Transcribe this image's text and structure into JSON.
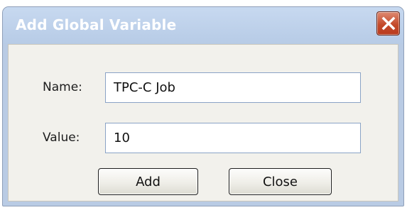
{
  "dialog": {
    "title": "Add Global Variable",
    "close_icon": "close-x-icon"
  },
  "form": {
    "name_label": "Name:",
    "name_value": "TPC-C Job",
    "value_label": "Value:",
    "value_value": "10"
  },
  "buttons": {
    "add_label": "Add",
    "close_label": "Close"
  },
  "colors": {
    "titlebar": "#b9cbe4",
    "close_button": "#c44a2b",
    "body": "#f2f1ec",
    "field_border": "#8aa3c6"
  }
}
